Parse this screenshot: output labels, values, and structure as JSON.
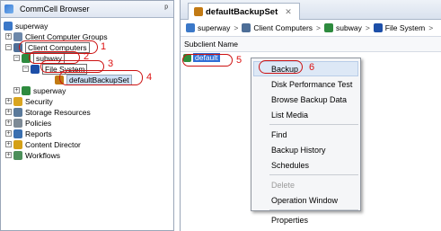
{
  "left_pane": {
    "title": "CommCell Browser",
    "tree": [
      {
        "label": "superway",
        "level": 0
      },
      {
        "label": "Client Computer Groups",
        "level": 1
      },
      {
        "label": "Client Computers",
        "level": 1
      },
      {
        "label": "subway",
        "level": 2
      },
      {
        "label": "File System",
        "level": 3
      },
      {
        "label": "defaultBackupSet",
        "level": 4
      },
      {
        "label": "superway",
        "level": 2
      },
      {
        "label": "Security",
        "level": 1
      },
      {
        "label": "Storage Resources",
        "level": 1
      },
      {
        "label": "Policies",
        "level": 1
      },
      {
        "label": "Reports",
        "level": 1
      },
      {
        "label": "Content Director",
        "level": 1
      },
      {
        "label": "Workflows",
        "level": 1
      }
    ]
  },
  "callouts": {
    "n1": "1",
    "n2": "2",
    "n3": "3",
    "n4": "4",
    "n5": "5",
    "n6": "6"
  },
  "right_pane": {
    "tab_label": "defaultBackupSet",
    "breadcrumb": [
      "superway",
      "Client Computers",
      "subway",
      "File System"
    ],
    "column_header": "Subclient Name",
    "rows": [
      "default"
    ]
  },
  "context_menu": {
    "items": [
      {
        "label": "Backup",
        "enabled": true
      },
      {
        "label": "Disk Performance Test",
        "enabled": true
      },
      {
        "label": "Browse Backup Data",
        "enabled": true
      },
      {
        "label": "List Media",
        "enabled": true
      },
      {
        "label": "Find",
        "enabled": true
      },
      {
        "label": "Backup History",
        "enabled": true
      },
      {
        "label": "Schedules",
        "enabled": true
      },
      {
        "label": "Delete",
        "enabled": false
      },
      {
        "label": "Operation Window",
        "enabled": true
      },
      {
        "label": "Properties",
        "enabled": true
      }
    ]
  },
  "colors": {
    "callout_red": "#cc1111",
    "selection_blue": "#2f6ed6",
    "menu_hover": "#dde8f6"
  }
}
